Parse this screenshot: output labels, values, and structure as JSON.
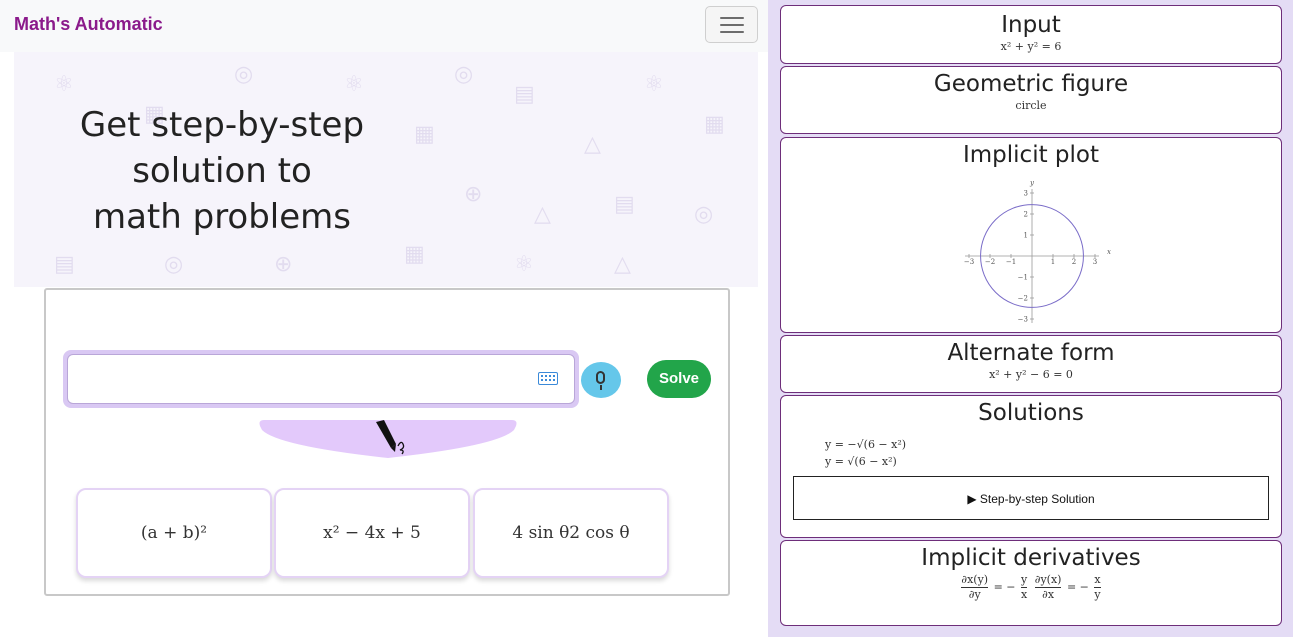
{
  "navbar": {
    "brand": "Math's Automatic",
    "menu_icon": "hamburger-icon"
  },
  "hero": {
    "line1": "Get step-by-step",
    "line2": "solution to",
    "line3": "math problems"
  },
  "input": {
    "placeholder": "",
    "keyboard_icon": "keyboard-icon",
    "mic_icon": "microphone-icon",
    "solve_label": "Solve",
    "handwriting_icon": "pen-icon"
  },
  "examples": [
    {
      "label": "(a + b)²"
    },
    {
      "label": "x² − 4x + 5"
    },
    {
      "label": "4 sin θ2 cos θ"
    }
  ],
  "results": {
    "input": {
      "title": "Input",
      "value": "x² + y² = 6"
    },
    "geometric": {
      "title": "Geometric figure",
      "value": "circle"
    },
    "implicit_plot": {
      "title": "Implicit plot"
    },
    "alternate": {
      "title": "Alternate form",
      "value": "x² + y² − 6 = 0"
    },
    "solutions": {
      "title": "Solutions",
      "line1": "y = −√(6 − x²)",
      "line2": "y = √(6 − x²)",
      "step_label": "Step-by-step Solution"
    },
    "derivatives": {
      "title": "Implicit derivatives"
    }
  },
  "chart_data": {
    "type": "line",
    "title": "",
    "xlabel": "x",
    "ylabel": "y",
    "xlim": [
      -3,
      3
    ],
    "ylim": [
      -3,
      3
    ],
    "x_ticks": [
      -3,
      -2,
      -1,
      1,
      2,
      3
    ],
    "y_ticks": [
      -3,
      -2,
      -1,
      1,
      2,
      3
    ],
    "x_tick_labels": [
      "−3",
      "−2",
      "−1",
      "1",
      "2",
      "3"
    ],
    "y_tick_labels": [
      "−3",
      "−2",
      "−1",
      "1",
      "2",
      "3"
    ],
    "series": [
      {
        "equation": "x^2 + y^2 = 6",
        "radius": 2.449,
        "color": "#7a6cc8"
      }
    ],
    "grid": false
  }
}
